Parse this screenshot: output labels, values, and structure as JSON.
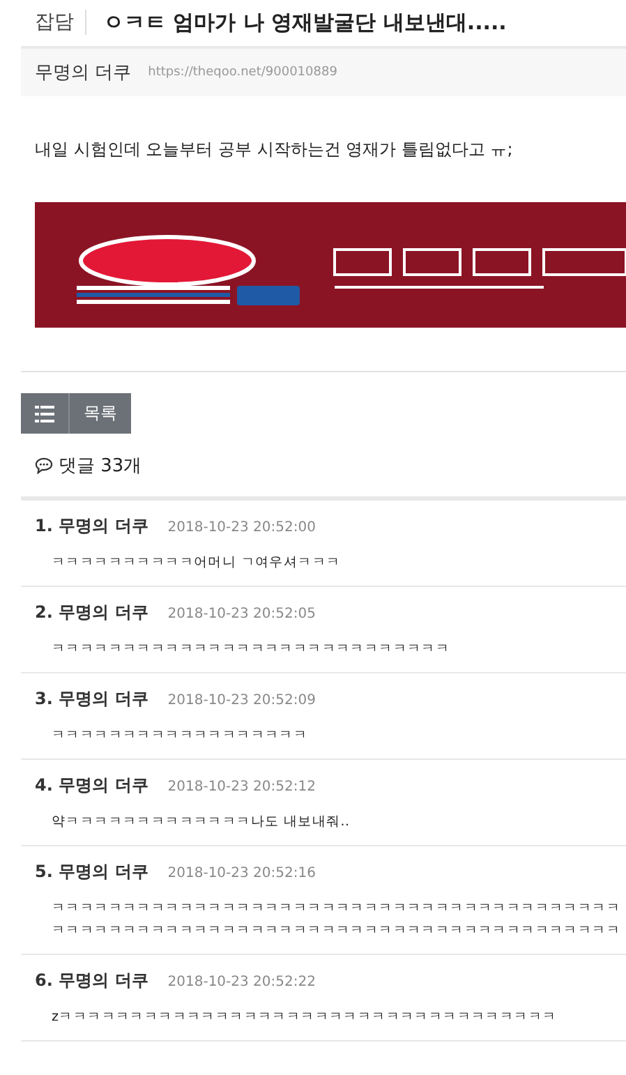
{
  "post": {
    "category": "잡담",
    "title": "ㅇㅋㅌ 엄마가 나 영재발굴단 내보낸대.....",
    "author": "무명의 더쿠",
    "url": "https://theqoo.net/900010889",
    "body": "내일 시험인데 오늘부터 공부 시작하는건 영재가 틀림없다고 ㅠ;"
  },
  "list_button": {
    "label": "목록"
  },
  "comments_header": {
    "label": "댓글 33개"
  },
  "comments": [
    {
      "number": "1.",
      "author": "무명의 더쿠",
      "time": "2018-10-23 20:52:00",
      "text": "ㅋㅋㅋㅋㅋㅋㅋㅋㅋㅋ어머니 ㄱ여우셔ㅋㅋㅋ"
    },
    {
      "number": "2.",
      "author": "무명의 더쿠",
      "time": "2018-10-23 20:52:05",
      "text": "ㅋㅋㅋㅋㅋㅋㅋㅋㅋㅋㅋㅋㅋㅋㅋㅋㅋㅋㅋㅋㅋㅋㅋㅋㅋㅋㅋㅋ"
    },
    {
      "number": "3.",
      "author": "무명의 더쿠",
      "time": "2018-10-23 20:52:09",
      "text": "ㅋㅋㅋㅋㅋㅋㅋㅋㅋㅋㅋㅋㅋㅋㅋㅋㅋㅋ"
    },
    {
      "number": "4.",
      "author": "무명의 더쿠",
      "time": "2018-10-23 20:52:12",
      "text": "약ㅋㅋㅋㅋㅋㅋㅋㅋㅋㅋㅋㅋㅋ나도 내보내줘.."
    },
    {
      "number": "5.",
      "author": "무명의 더쿠",
      "time": "2018-10-23 20:52:16",
      "text": "ㅋㅋㅋㅋㅋㅋㅋㅋㅋㅋㅋㅋㅋㅋㅋㅋㅋㅋㅋㅋㅋㅋㅋㅋㅋㅋㅋㅋㅋㅋㅋㅋㅋㅋㅋㅋㅋㅋㅋㅋ",
      "text_2": "ㅋㅋㅋㅋㅋㅋㅋㅋㅋㅋㅋㅋㅋㅋㅋㅋㅋㅋㅋㅋㅋㅋㅋㅋㅋㅋㅋㅋㅋㅋㅋㅋㅋㅋㅋㅋㅋㅋㅋㅋ"
    },
    {
      "number": "6.",
      "author": "무명의 더쿠",
      "time": "2018-10-23 20:52:22",
      "text": "zㅋㅋㅋㅋㅋㅋㅋㅋㅋㅋㅋㅋㅋㅋㅋㅋㅋㅋㅋㅋㅋㅋㅋㅋㅋㅋㅋㅋㅋㅋㅋㅋㅋㅋㅋ"
    }
  ]
}
